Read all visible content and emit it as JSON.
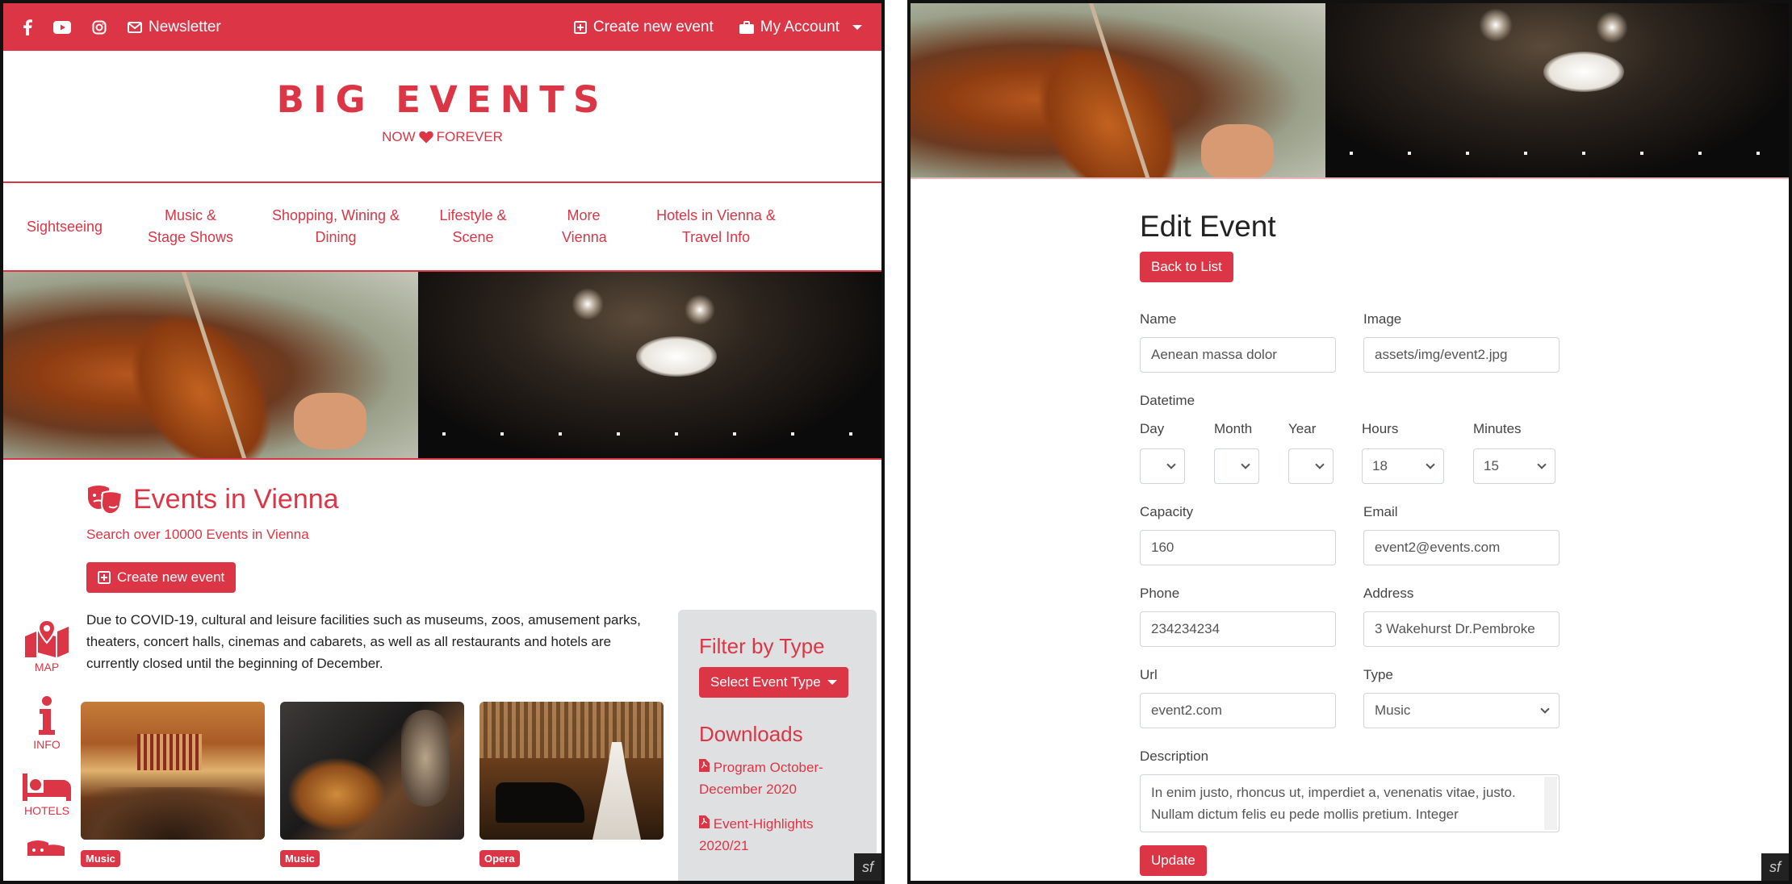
{
  "left": {
    "topbar": {
      "newsletter": "Newsletter",
      "create_event": "Create new event",
      "my_account": "My Account"
    },
    "brand": {
      "title": "BIG EVENTS",
      "tag_left": "NOW",
      "tag_right": "FOREVER"
    },
    "nav": [
      "Sightseeing",
      "Music & Stage Shows",
      "Shopping, Wining & Dining",
      "Lifestyle & Scene",
      "More Vienna",
      "Hotels in Vienna & Travel Info"
    ],
    "events": {
      "title": "Events in Vienna",
      "subtitle": "Search over 10000 Events in Vienna",
      "create_button": "Create new event",
      "covid_text": "Due to COVID-19, cultural and leisure facilities such as museums, zoos, amusement parks, theaters, concert halls, cinemas and cabarets, as well as all restaurants and hotels are currently closed until the beginning of December."
    },
    "side_icons": [
      {
        "label": "MAP",
        "icon": "map-pin-icon"
      },
      {
        "label": "INFO",
        "icon": "info-icon"
      },
      {
        "label": "HOTELS",
        "icon": "bed-icon"
      }
    ],
    "cards": [
      {
        "badge": "Music"
      },
      {
        "badge": "Music"
      },
      {
        "badge": "Opera"
      }
    ],
    "filter": {
      "heading": "Filter by Type",
      "select_label": "Select Event Type",
      "downloads_heading": "Downloads",
      "downloads": [
        "Program October-December 2020",
        "Event-Highlights 2020/21"
      ]
    }
  },
  "right": {
    "title": "Edit Event",
    "back_button": "Back to List",
    "labels": {
      "name": "Name",
      "image": "Image",
      "datetime": "Datetime",
      "day": "Day",
      "month": "Month",
      "year": "Year",
      "hours": "Hours",
      "minutes": "Minutes",
      "capacity": "Capacity",
      "email": "Email",
      "phone": "Phone",
      "address": "Address",
      "url": "Url",
      "type": "Type",
      "description": "Description"
    },
    "values": {
      "name": "Aenean massa dolor",
      "image": "assets/img/event2.jpg",
      "day": "",
      "month": "",
      "year": "",
      "hours": "18",
      "minutes": "15",
      "capacity": "160",
      "email": "event2@events.com",
      "phone": "234234234",
      "address": "3 Wakehurst Dr.Pembroke",
      "url": "event2.com",
      "type": "Music",
      "description": "In enim justo, rhoncus ut, imperdiet a, venenatis vitae, justo. Nullam dictum felis eu pede mollis pretium. Integer"
    },
    "update_button": "Update"
  },
  "colors": {
    "accent": "#dc3545",
    "filter_bg": "#dfe0e2"
  }
}
